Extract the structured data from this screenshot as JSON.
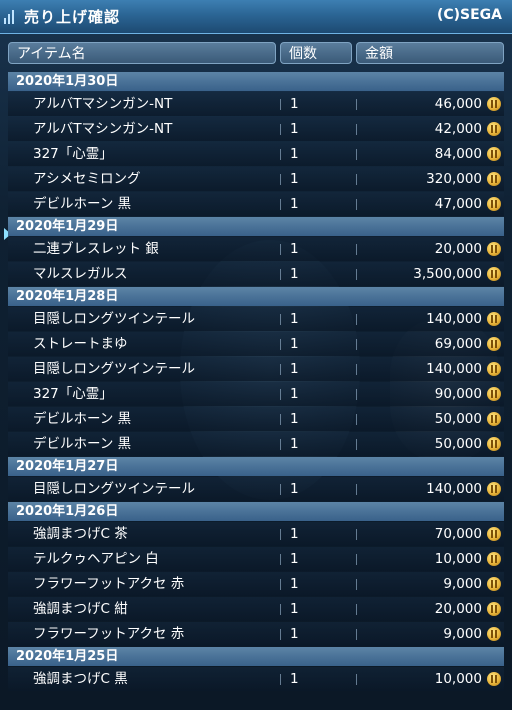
{
  "window": {
    "title": "売り上げ確認",
    "publisher": "(C)SEGA"
  },
  "columns": {
    "item": "アイテム名",
    "qty": "個数",
    "price": "金額"
  },
  "groups": [
    {
      "date": "2020年1月30日",
      "items": [
        {
          "name": "アルバTマシンガン-NT",
          "qty": "1",
          "price": "46,000"
        },
        {
          "name": "アルバTマシンガン-NT",
          "qty": "1",
          "price": "42,000"
        },
        {
          "name": "327「心霊」",
          "qty": "1",
          "price": "84,000"
        },
        {
          "name": "アシメセミロング",
          "qty": "1",
          "price": "320,000"
        },
        {
          "name": "デビルホーン 黒",
          "qty": "1",
          "price": "47,000"
        }
      ]
    },
    {
      "date": "2020年1月29日",
      "items": [
        {
          "name": "二連ブレスレット 銀",
          "qty": "1",
          "price": "20,000"
        },
        {
          "name": "マルスレガルス",
          "qty": "1",
          "price": "3,500,000"
        }
      ]
    },
    {
      "date": "2020年1月28日",
      "items": [
        {
          "name": "目隠しロングツインテール",
          "qty": "1",
          "price": "140,000"
        },
        {
          "name": "ストレートまゆ",
          "qty": "1",
          "price": "69,000"
        },
        {
          "name": "目隠しロングツインテール",
          "qty": "1",
          "price": "140,000"
        },
        {
          "name": "327「心霊」",
          "qty": "1",
          "price": "90,000"
        },
        {
          "name": "デビルホーン 黒",
          "qty": "1",
          "price": "50,000"
        },
        {
          "name": "デビルホーン 黒",
          "qty": "1",
          "price": "50,000"
        }
      ]
    },
    {
      "date": "2020年1月27日",
      "items": [
        {
          "name": "目隠しロングツインテール",
          "qty": "1",
          "price": "140,000"
        }
      ]
    },
    {
      "date": "2020年1月26日",
      "items": [
        {
          "name": "強調まつげC 茶",
          "qty": "1",
          "price": "70,000"
        },
        {
          "name": "テルクゥヘアピン 白",
          "qty": "1",
          "price": "10,000"
        },
        {
          "name": "フラワーフットアクセ 赤",
          "qty": "1",
          "price": "9,000"
        },
        {
          "name": "強調まつげC 紺",
          "qty": "1",
          "price": "20,000"
        },
        {
          "name": "フラワーフットアクセ 赤",
          "qty": "1",
          "price": "9,000"
        }
      ]
    },
    {
      "date": "2020年1月25日",
      "items": [
        {
          "name": "強調まつげC 黒",
          "qty": "1",
          "price": "10,000"
        }
      ]
    }
  ],
  "icons": {
    "title": "window-bars-icon",
    "currency": "meseta-coin-icon",
    "cursor": "cursor-arrow-icon"
  },
  "colors": {
    "titlebar": "#2b6594",
    "date_header": "#4a7398",
    "coin": "#e8b43a"
  }
}
